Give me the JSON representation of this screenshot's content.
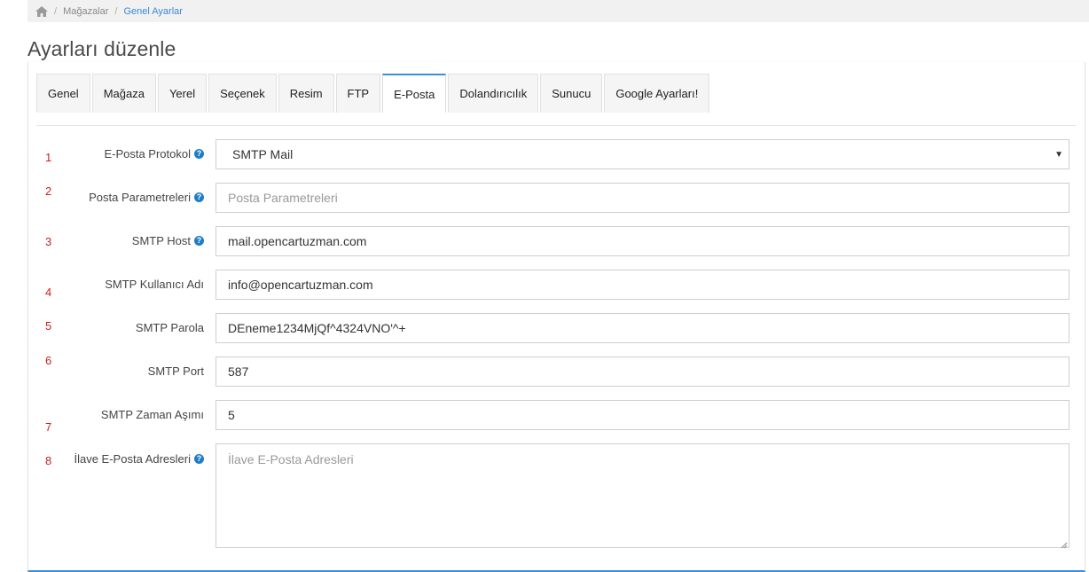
{
  "breadcrumb": {
    "items": [
      {
        "label": "Mağazalar"
      },
      {
        "label": "Genel Ayarlar"
      }
    ]
  },
  "page": {
    "title": "Ayarları düzenle"
  },
  "tabs": [
    {
      "label": "Genel"
    },
    {
      "label": "Mağaza"
    },
    {
      "label": "Yerel"
    },
    {
      "label": "Seçenek"
    },
    {
      "label": "Resim"
    },
    {
      "label": "FTP"
    },
    {
      "label": "E-Posta"
    },
    {
      "label": "Dolandırıcılık"
    },
    {
      "label": "Sunucu"
    },
    {
      "label": "Google Ayarları!"
    }
  ],
  "form": {
    "protocol": {
      "num": "1",
      "label": "E-Posta Protokol",
      "value": "SMTP Mail"
    },
    "params": {
      "num": "2",
      "label": "Posta Parametreleri",
      "placeholder": "Posta Parametreleri"
    },
    "host": {
      "num": "3",
      "label": "SMTP Host",
      "value": "mail.opencartuzman.com"
    },
    "username": {
      "num": "4",
      "label": "SMTP Kullanıcı Adı",
      "value": "info@opencartuzman.com"
    },
    "password": {
      "num": "5",
      "label": "SMTP Parola",
      "value": "DEneme1234MjQf^4324VNO'^+"
    },
    "port": {
      "num": "6",
      "label": "SMTP Port",
      "value": "587"
    },
    "timeout": {
      "num": "7",
      "label": "SMTP Zaman Aşımı",
      "value": "5"
    },
    "extra": {
      "num": "8",
      "label": "İlave E-Posta Adresleri",
      "placeholder": "İlave E-Posta Adresleri"
    }
  },
  "colors": {
    "accent": "#3a8fd6",
    "number": "#cc1f1f"
  }
}
